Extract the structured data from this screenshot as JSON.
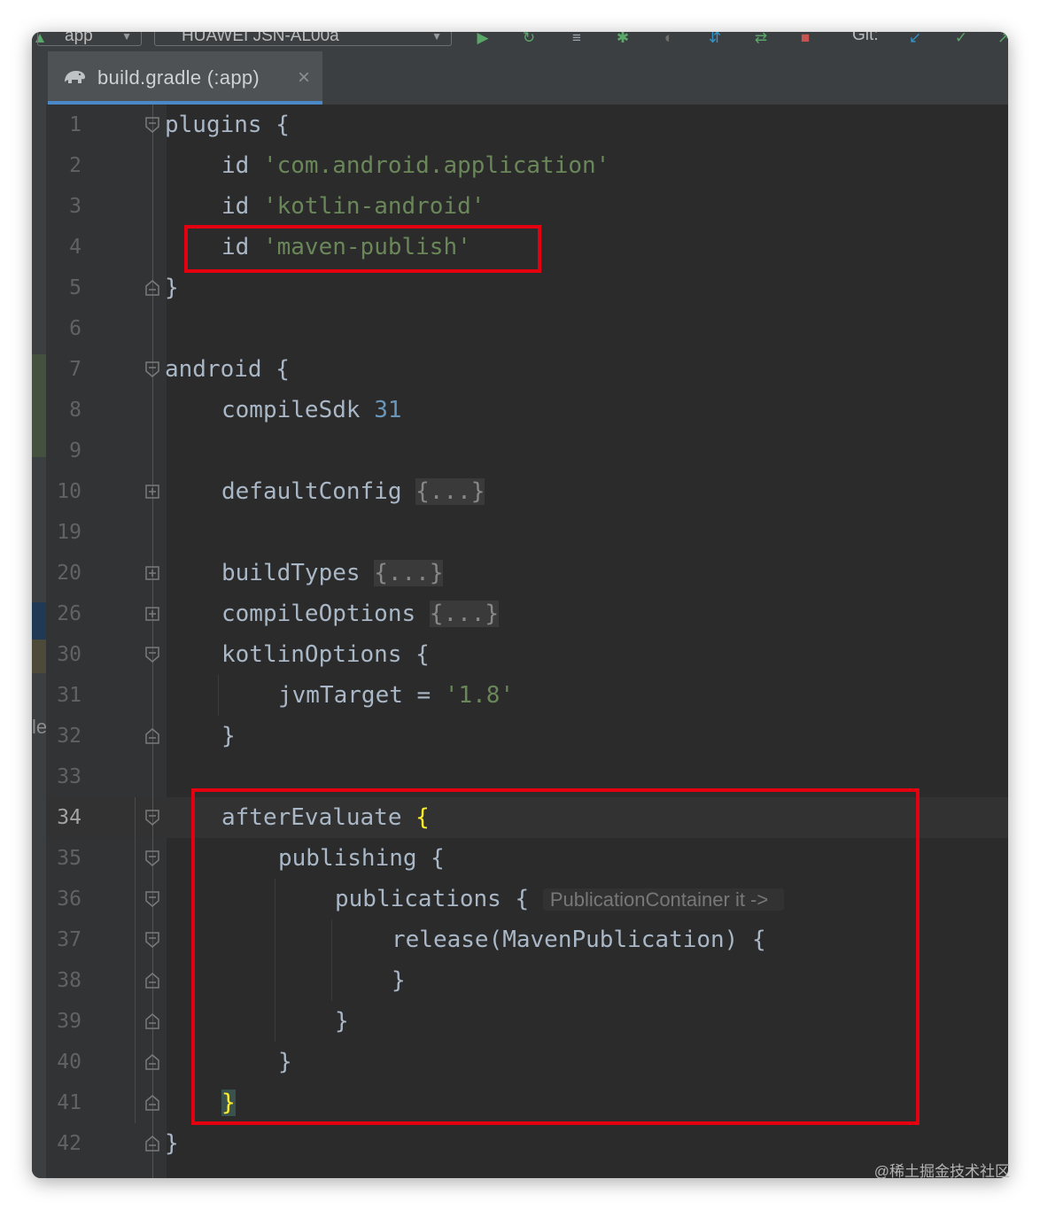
{
  "toolbar": {
    "module_combo": "app",
    "device_combo": "HUAWEI JSN-AL00a",
    "git_label": "Git:",
    "icons": [
      "run-app-icon",
      "apply-code-changes-icon",
      "apply-changes-restart-icon",
      "debug-icon",
      "profiler-icon",
      "attach-debugger-icon",
      "sync-gradle-icon",
      "stop-icon",
      "git-update-icon",
      "git-commit-icon"
    ]
  },
  "tab": {
    "label": "build.gradle (:app)",
    "icon": "gradle-elephant-icon",
    "close": "×"
  },
  "side_text": "le",
  "lines": {
    "l1": "1",
    "l2": "2",
    "l3": "3",
    "l4": "4",
    "l5": "5",
    "l6": "6",
    "l7": "7",
    "l8": "8",
    "l9": "9",
    "l10": "10",
    "l19": "19",
    "l20": "20",
    "l26": "26",
    "l30": "30",
    "l31": "31",
    "l32": "32",
    "l33": "33",
    "l34": "34",
    "l35": "35",
    "l36": "36",
    "l37": "37",
    "l38": "38",
    "l39": "39",
    "l40": "40",
    "l41": "41",
    "l42": "42"
  },
  "code": {
    "plugins": "plugins {",
    "id_kw": "id",
    "id1": "'com.android.application'",
    "id2": "'kotlin-android'",
    "id3": "'maven-publish'",
    "close": "}",
    "android": "android {",
    "compileSdk": "compileSdk",
    "compileSdk_val": "31",
    "defaultConfig": "defaultConfig",
    "collapsed": "{...}",
    "buildTypes": "buildTypes",
    "compileOptions": "compileOptions",
    "kotlinOptions": "kotlinOptions {",
    "jvmTarget": "jvmTarget = ",
    "jvmTarget_val": "'1.8'",
    "afterEvaluate": "afterEvaluate ",
    "open_brace": "{",
    "publishing": "publishing {",
    "publications": "publications { ",
    "publications_hint": "PublicationContainer it ->",
    "release": "release(MavenPublication) {"
  },
  "watermark": "@稀土掘金技术社区",
  "colors": {
    "editor_bg": "#2b2b2b",
    "keyword": "#a9b7c6",
    "string": "#6a8759",
    "number": "#6897bb",
    "highlight_box": "#e3000f",
    "brace_match": "#ffef28",
    "tab_underline": "#4a88c7"
  }
}
